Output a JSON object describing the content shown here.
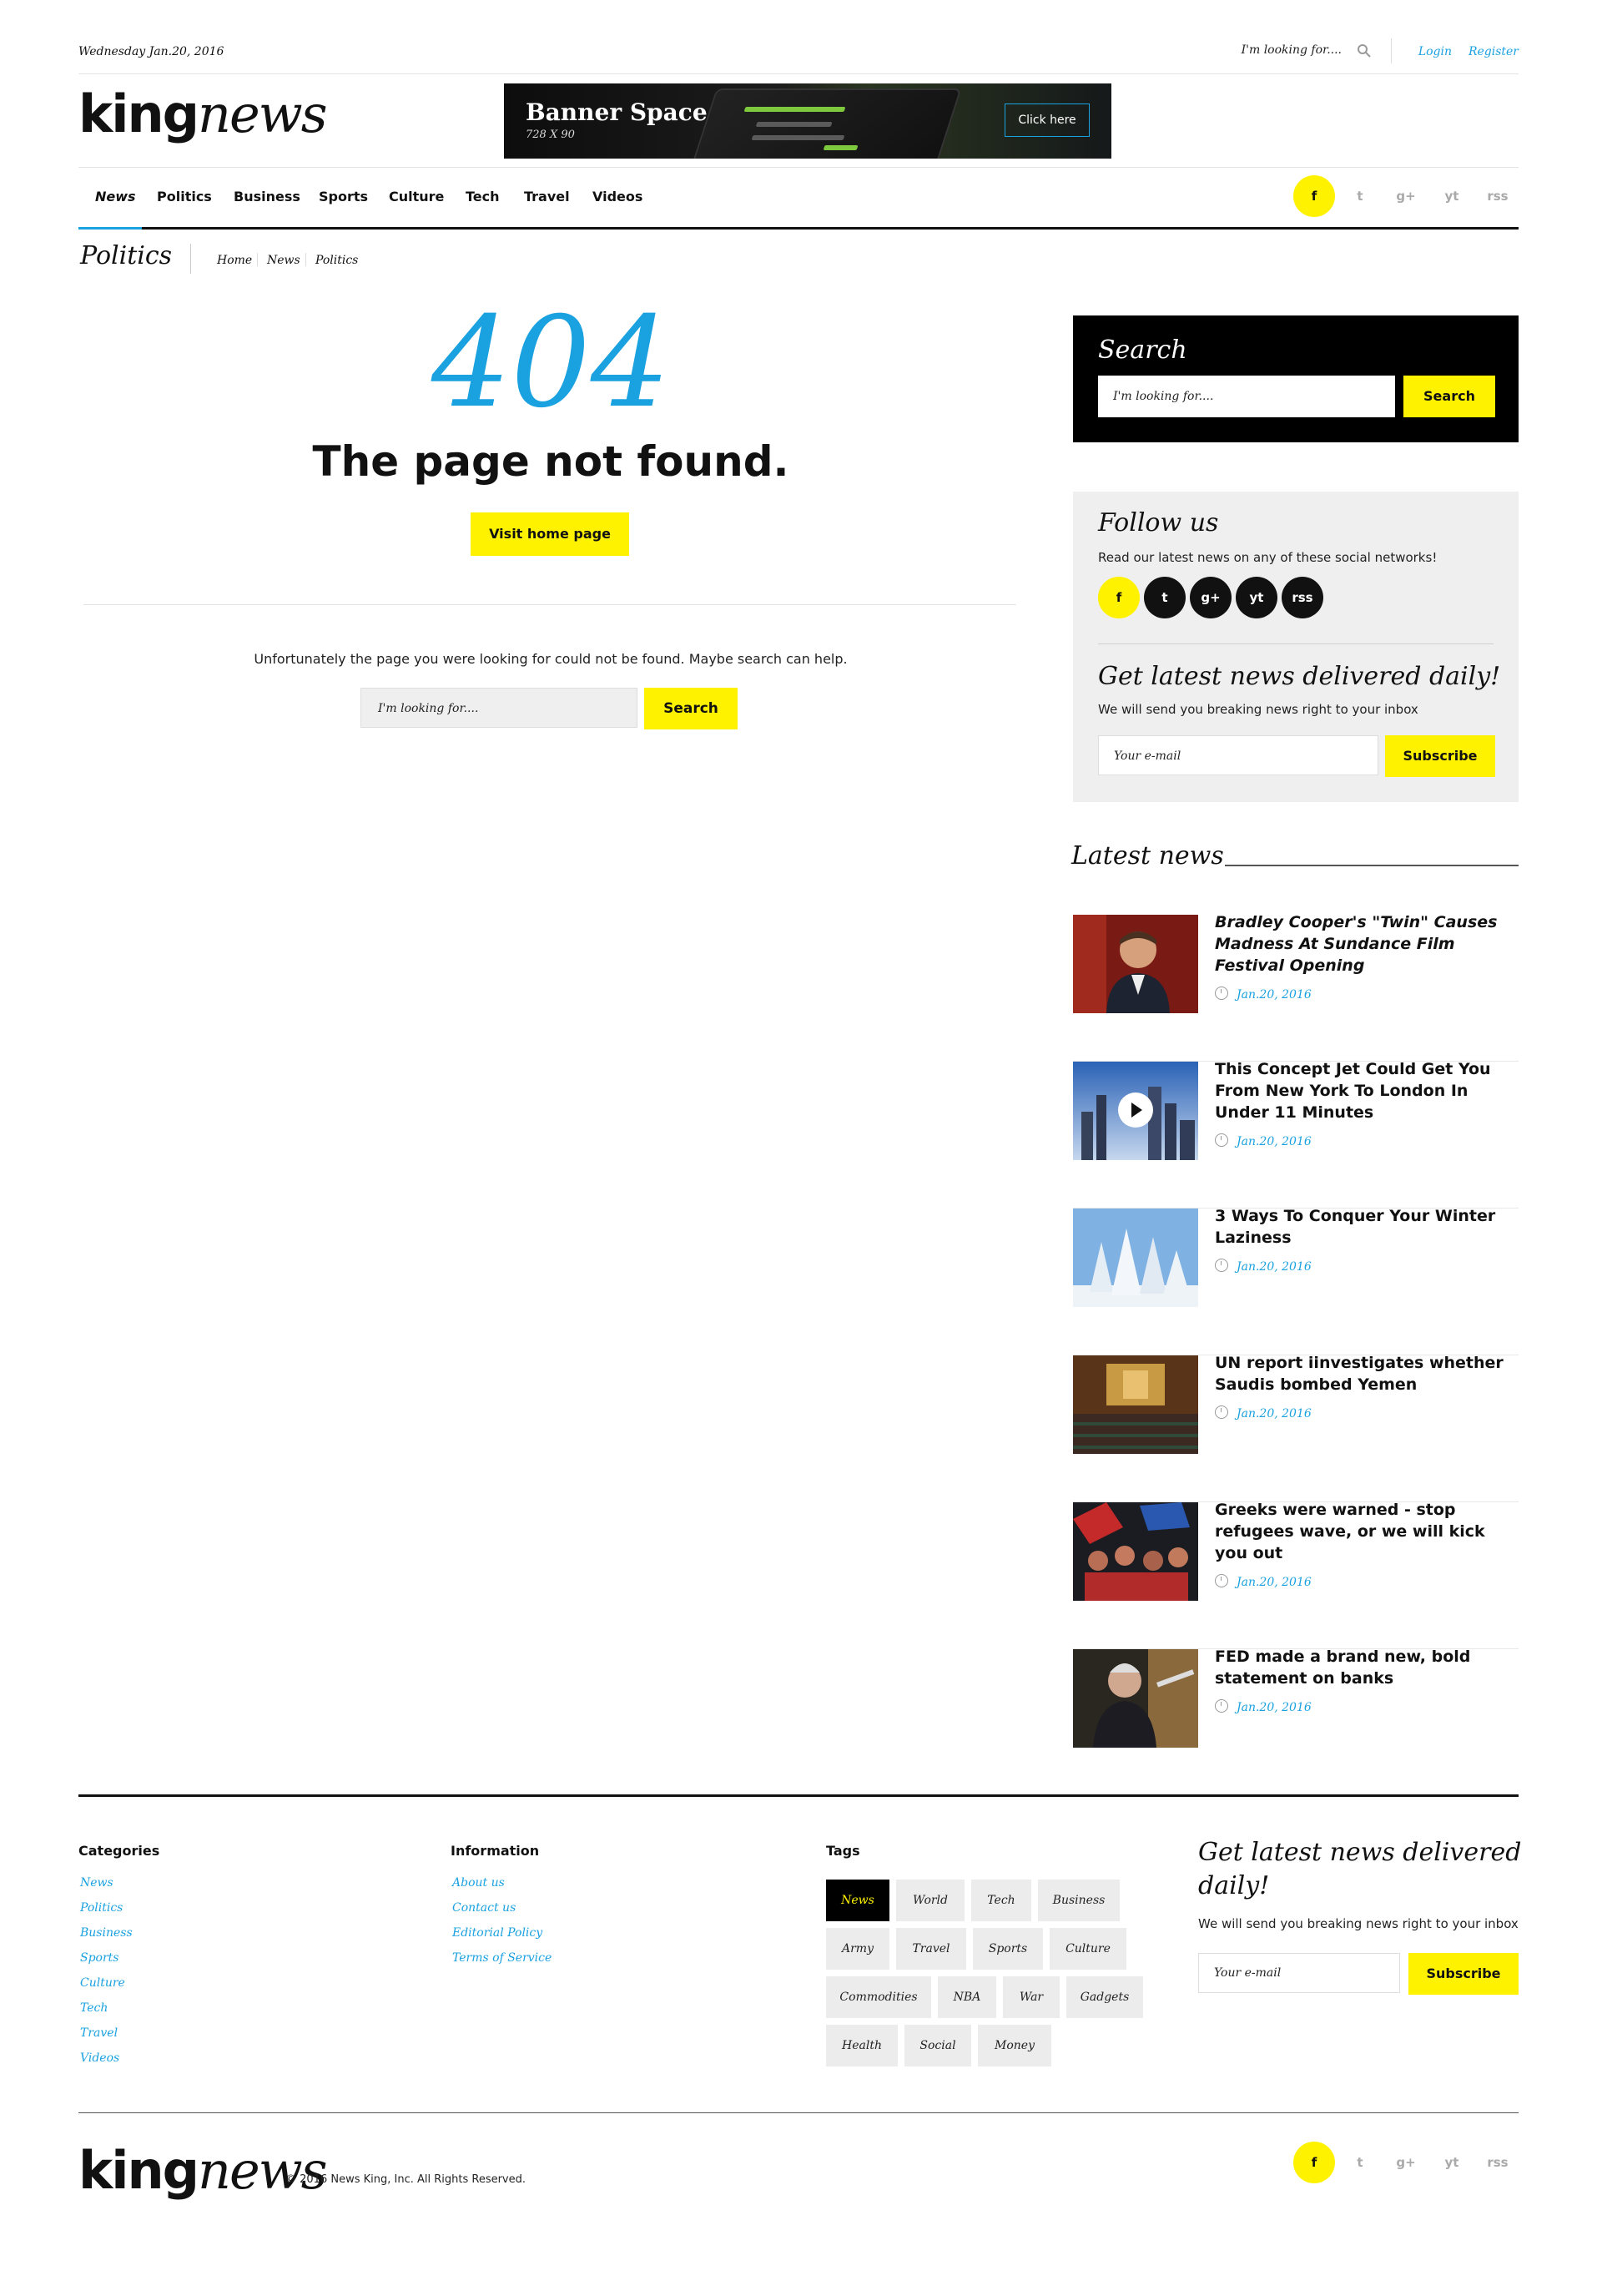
{
  "topbar": {
    "date": "Wednesday Jan.20, 2016",
    "search_placeholder": "I'm looking for....",
    "login": "Login",
    "register": "Register"
  },
  "header": {
    "logo_bold": "king",
    "logo_italic": "news",
    "banner": {
      "title": "Banner Space",
      "size": "728 X 90",
      "button": "Click here"
    }
  },
  "nav": {
    "items": [
      "News",
      "Politics",
      "Business",
      "Sports",
      "Culture",
      "Tech",
      "Travel",
      "Videos"
    ],
    "social": [
      "f",
      "t",
      "g+",
      "yt",
      "rss"
    ]
  },
  "page": {
    "title": "Politics",
    "breadcrumb": [
      "Home",
      "News",
      "Politics"
    ]
  },
  "error": {
    "code": "404",
    "headline": "The page not found.",
    "visit_button": "Visit home page",
    "message": "Unfortunately the page you were looking for could not be found. Maybe search can help.",
    "search_placeholder": "I'm looking for....",
    "search_button": "Search"
  },
  "sidebar": {
    "search": {
      "title": "Search",
      "placeholder": "I'm looking for....",
      "button": "Search"
    },
    "follow": {
      "title": "Follow us",
      "text": "Read our latest news on any of these social networks!",
      "icons": [
        "f",
        "t",
        "g+",
        "yt",
        "rss"
      ]
    },
    "newsletter": {
      "title": "Get latest news delivered daily!",
      "text": "We will send you breaking news right to your inbox",
      "placeholder": "Your e-mail",
      "button": "Subscribe"
    },
    "latest_title": "Latest news",
    "latest": [
      {
        "title": "Bradley Cooper's \"Twin\" Causes Madness At Sundance Film Festival Opening",
        "date": "Jan.20, 2016",
        "italic": true
      },
      {
        "title": "This Concept Jet Could Get You From New York To London In Under 11 Minutes",
        "date": "Jan.20, 2016",
        "italic": false
      },
      {
        "title": "3 Ways To Conquer Your Winter Laziness",
        "date": "Jan.20, 2016",
        "italic": false
      },
      {
        "title": "UN report iinvestigates whether Saudis bombed Yemen",
        "date": "Jan.20, 2016",
        "italic": false
      },
      {
        "title": "Greeks were warned - stop refugees wave, or we will kick you out",
        "date": "Jan.20, 2016",
        "italic": false
      },
      {
        "title": "FED made a brand new, bold statement on banks",
        "date": "Jan.20, 2016",
        "italic": false
      }
    ]
  },
  "footer": {
    "categories_title": "Categories",
    "categories": [
      "News",
      "Politics",
      "Business",
      "Sports",
      "Culture",
      "Tech",
      "Travel",
      "Videos"
    ],
    "information_title": "Information",
    "information": [
      "About us",
      "Contact us",
      "Editorial Policy",
      "Terms of Service"
    ],
    "tags_title": "Tags",
    "tags": [
      "News",
      "World",
      "Tech",
      "Business",
      "Army",
      "Travel",
      "Sports",
      "Culture",
      "Commodities",
      "NBA",
      "War",
      "Gadgets",
      "Health",
      "Social",
      "Money"
    ],
    "newsletter_title": "Get latest news delivered daily!",
    "newsletter_text": "We will send you breaking news right to your inbox",
    "newsletter_placeholder": "Your e-mail",
    "newsletter_button": "Subscribe",
    "copyright": "© 2016 News King, Inc. All Rights Reserved.",
    "social": [
      "f",
      "t",
      "g+",
      "yt",
      "rss"
    ]
  },
  "colors": {
    "accent_yellow": "#fff200",
    "link_blue": "#1aa1e0",
    "dark": "#111111"
  }
}
